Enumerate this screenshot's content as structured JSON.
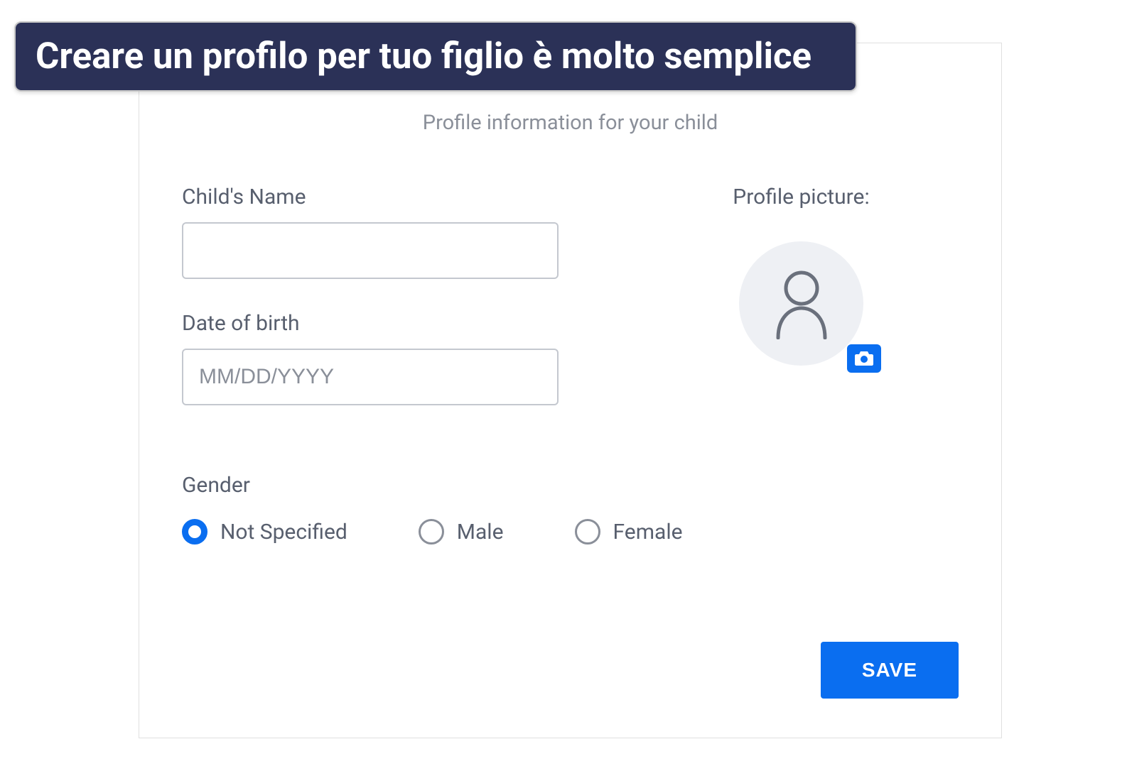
{
  "banner": {
    "text": "Creare un profilo per tuo figlio è molto semplice"
  },
  "card": {
    "subtitle": "Profile information for your child",
    "name_label": "Child's Name",
    "name_value": "",
    "dob_label": "Date of birth",
    "dob_placeholder": "MM/DD/YYYY",
    "dob_value": "",
    "profile_pic_label": "Profile picture:",
    "gender_label": "Gender",
    "gender_options": {
      "not_specified": "Not Specified",
      "male": "Male",
      "female": "Female"
    },
    "gender_selected": "not_specified",
    "save_label": "SAVE"
  },
  "colors": {
    "banner_bg": "#2b3157",
    "accent": "#0a6ef0",
    "text_muted": "#585f6e",
    "avatar_bg": "#eef0f4"
  }
}
